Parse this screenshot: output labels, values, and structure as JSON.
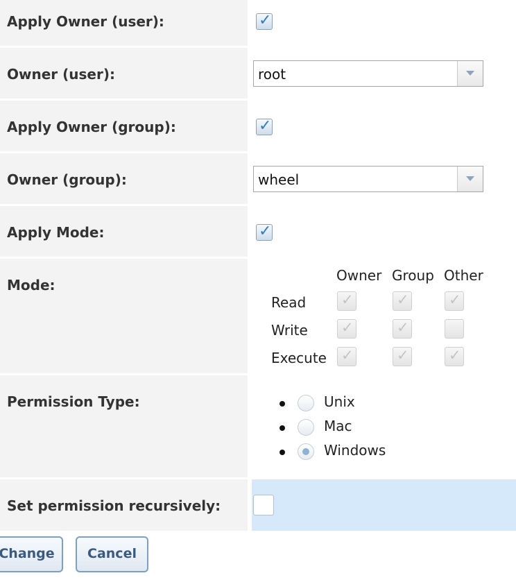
{
  "rows": {
    "apply_owner_user": {
      "label": "Apply Owner (user):",
      "checked": true
    },
    "owner_user": {
      "label": "Owner (user):",
      "value": "root"
    },
    "apply_owner_group": {
      "label": "Apply Owner (group):",
      "checked": true
    },
    "owner_group": {
      "label": "Owner (group):",
      "value": "wheel"
    },
    "apply_mode": {
      "label": "Apply Mode:",
      "checked": true
    },
    "mode": {
      "label": "Mode:",
      "columns": [
        "Owner",
        "Group",
        "Other"
      ],
      "rows": [
        {
          "name": "Read",
          "owner": true,
          "group": true,
          "other": true
        },
        {
          "name": "Write",
          "owner": true,
          "group": true,
          "other": false
        },
        {
          "name": "Execute",
          "owner": true,
          "group": true,
          "other": true
        }
      ]
    },
    "permission_type": {
      "label": "Permission Type:",
      "options": [
        "Unix",
        "Mac",
        "Windows"
      ],
      "selected": "Windows"
    },
    "recursive": {
      "label": "Set permission recursively:",
      "checked": false
    }
  },
  "buttons": {
    "change": "Change",
    "cancel": "Cancel"
  },
  "colors": {
    "label_bg": "#f3f3f3",
    "highlight_bg": "#d6e9fb",
    "checkbox_check": "#2f7fc4",
    "button_border": "#7aa0c8",
    "button_text": "#3a5a80"
  }
}
